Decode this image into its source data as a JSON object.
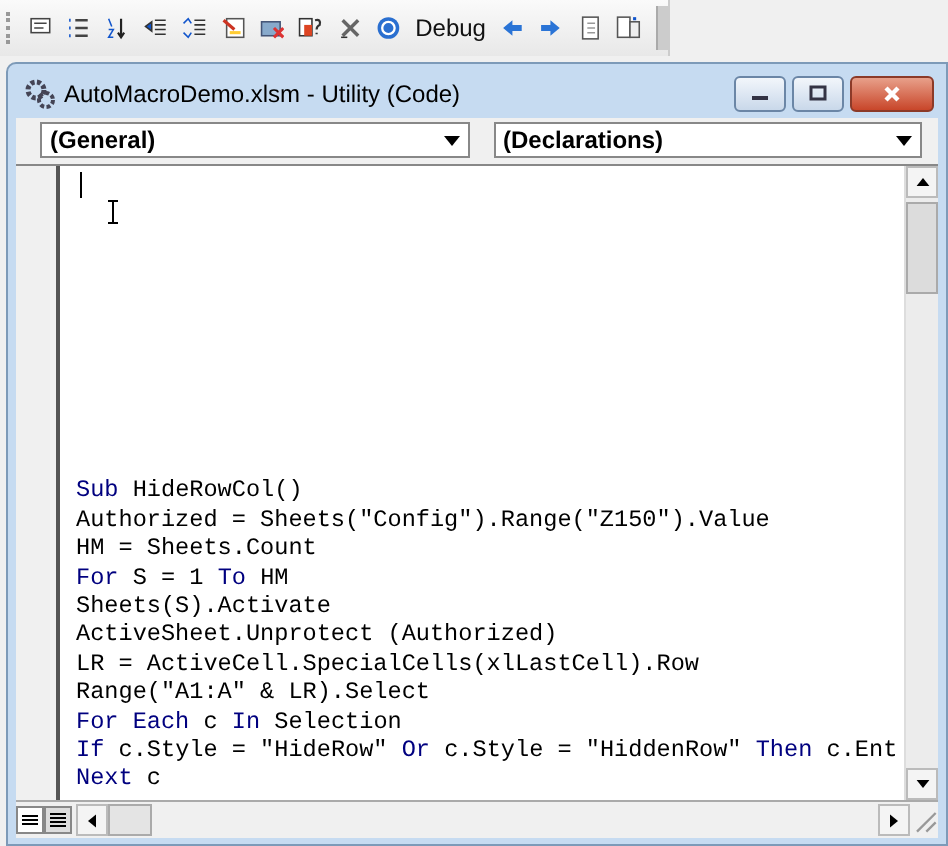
{
  "toolbar": {
    "label": "Debug"
  },
  "window": {
    "title": "AutoMacroDemo.xlsm - Utility (Code)"
  },
  "object_dropdown": {
    "value": "(General)"
  },
  "procedure_dropdown": {
    "value": "(Declarations)"
  },
  "code": {
    "lines": [
      [
        {
          "kind": "keyword",
          "text": "Sub"
        },
        {
          "kind": "plain",
          "text": " HideRowCol()"
        }
      ],
      [
        {
          "kind": "plain",
          "text": "Authorized = Sheets(\"Config\").Range(\"Z150\").Value"
        }
      ],
      [
        {
          "kind": "plain",
          "text": "HM = Sheets.Count"
        }
      ],
      [
        {
          "kind": "keyword",
          "text": "For"
        },
        {
          "kind": "plain",
          "text": " S = 1 "
        },
        {
          "kind": "keyword",
          "text": "To"
        },
        {
          "kind": "plain",
          "text": " HM"
        }
      ],
      [
        {
          "kind": "plain",
          "text": "Sheets(S).Activate"
        }
      ],
      [
        {
          "kind": "plain",
          "text": "ActiveSheet.Unprotect (Authorized)"
        }
      ],
      [
        {
          "kind": "plain",
          "text": "LR = ActiveCell.SpecialCells(xlLastCell).Row"
        }
      ],
      [
        {
          "kind": "plain",
          "text": "Range(\"A1:A\" & LR).Select"
        }
      ],
      [
        {
          "kind": "keyword",
          "text": "For Each"
        },
        {
          "kind": "plain",
          "text": " c "
        },
        {
          "kind": "keyword",
          "text": "In"
        },
        {
          "kind": "plain",
          "text": " Selection"
        }
      ],
      [
        {
          "kind": "keyword",
          "text": "If"
        },
        {
          "kind": "plain",
          "text": " c.Style = \"HideRow\" "
        },
        {
          "kind": "keyword",
          "text": "Or"
        },
        {
          "kind": "plain",
          "text": " c.Style = \"HiddenRow\" "
        },
        {
          "kind": "keyword",
          "text": "Then"
        },
        {
          "kind": "plain",
          "text": " c.Ent"
        }
      ],
      [
        {
          "kind": "keyword",
          "text": "Next"
        },
        {
          "kind": "plain",
          "text": " c"
        }
      ]
    ]
  }
}
